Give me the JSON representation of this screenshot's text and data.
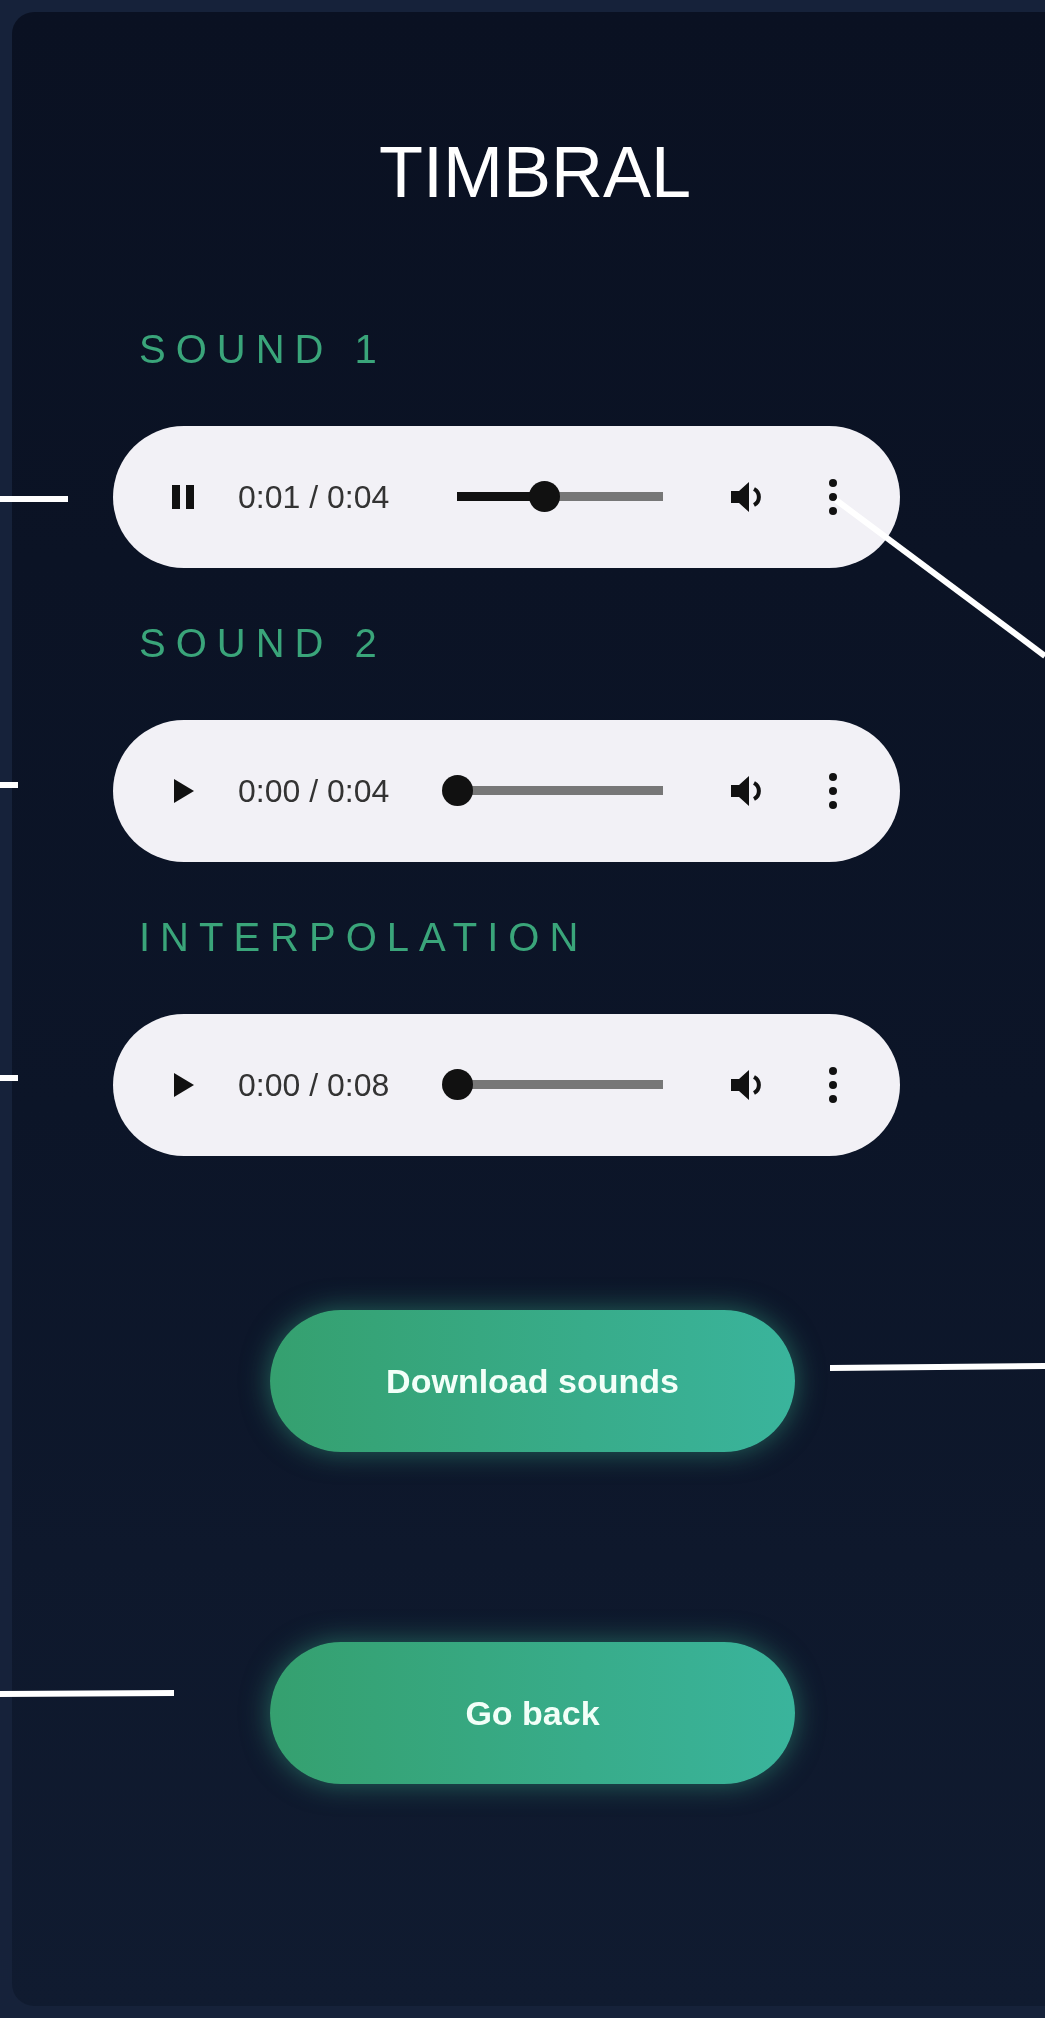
{
  "title": "TIMBRAL",
  "sounds": [
    {
      "label": "SOUND 1",
      "player": {
        "playing": true,
        "time": "0:01 / 0:04",
        "level": 0.42
      }
    },
    {
      "label": "SOUND 2",
      "player": {
        "playing": false,
        "time": "0:00 / 0:04",
        "level": 0
      }
    },
    {
      "label": "INTERPOLATION",
      "player": {
        "playing": false,
        "time": "0:00 / 0:08",
        "level": 0
      }
    }
  ],
  "buttons": [
    {
      "label": "Download sounds"
    },
    {
      "label": "Go back"
    }
  ]
}
